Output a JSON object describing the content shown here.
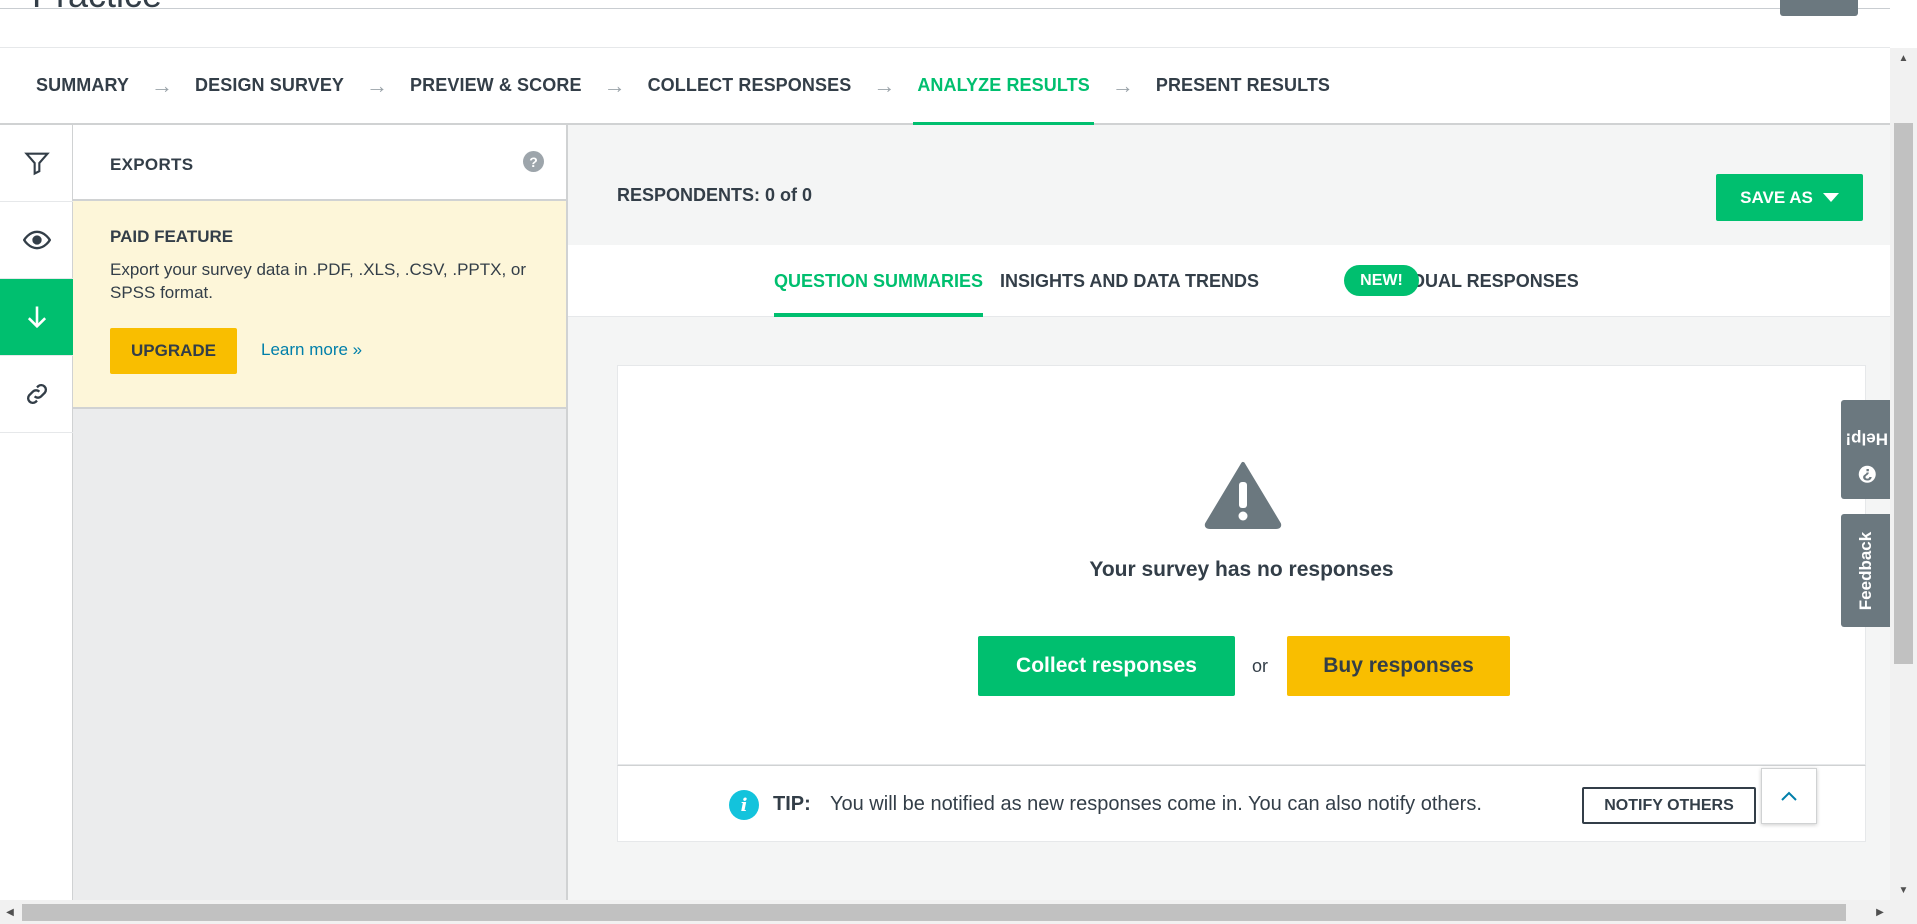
{
  "page": {
    "title": "Practice"
  },
  "steps": [
    {
      "label": "SUMMARY",
      "active": false
    },
    {
      "label": "DESIGN SURVEY",
      "active": false
    },
    {
      "label": "PREVIEW & SCORE",
      "active": false
    },
    {
      "label": "COLLECT RESPONSES",
      "active": false
    },
    {
      "label": "ANALYZE RESULTS",
      "active": true
    },
    {
      "label": "PRESENT RESULTS",
      "active": false
    }
  ],
  "rail": [
    {
      "icon": "filter-icon",
      "active": false
    },
    {
      "icon": "eye-icon",
      "active": false
    },
    {
      "icon": "download-icon",
      "active": true
    },
    {
      "icon": "link-icon",
      "active": false
    }
  ],
  "panel": {
    "title": "EXPORTS",
    "help_label": "?",
    "paid": {
      "title": "PAID FEATURE",
      "description": "Export your survey data in .PDF, .XLS, .CSV, .PPTX, or SPSS format.",
      "upgrade_label": "UPGRADE",
      "learn_more_label": "Learn more »"
    }
  },
  "main": {
    "respondents": "RESPONDENTS: 0 of 0",
    "save_as_label": "SAVE AS",
    "tabs": [
      {
        "label": "QUESTION SUMMARIES",
        "active": true
      },
      {
        "label": "INSIGHTS AND DATA TRENDS",
        "active": false
      },
      {
        "label": "INDIVIDUAL RESPONSES",
        "active": false
      }
    ],
    "new_badge": "NEW!",
    "empty": {
      "message": "Your survey has no responses",
      "collect_label": "Collect responses",
      "or_label": "or",
      "buy_label": "Buy responses"
    },
    "tip": {
      "label": "TIP:",
      "text": "You will be notified as new responses come in. You can also notify others.",
      "notify_label": "NOTIFY OTHERS"
    }
  },
  "side_tabs": {
    "help": "Help!",
    "feedback": "Feedback"
  },
  "colors": {
    "accent": "#00bf6f",
    "warning": "#f9be00",
    "text": "#333e48",
    "info": "#13c3dc",
    "side_tab": "#6b787f"
  }
}
